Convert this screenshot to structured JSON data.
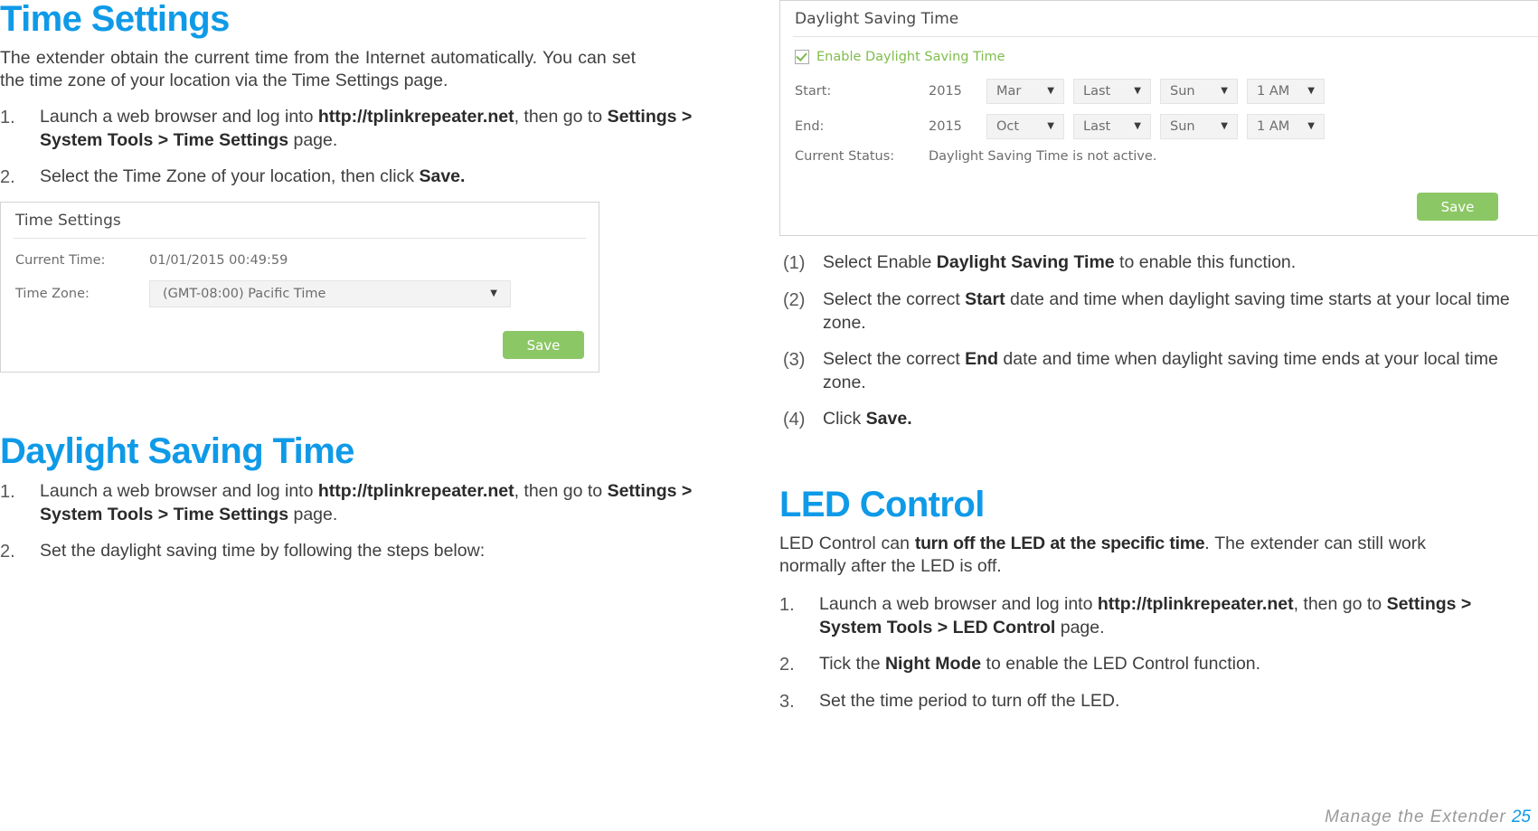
{
  "left_column": {
    "time_settings": {
      "heading": "Time Settings",
      "intro": "The extender obtain the current time from the Internet automatically. You can set the time zone of your location via the Time Settings page.",
      "steps": [
        {
          "num": "1.",
          "parts": [
            {
              "t": "Launch a web browser and log into ",
              "b": false
            },
            {
              "t": "http://tplinkrepeater.net",
              "b": true
            },
            {
              "t": ", then go to ",
              "b": false
            },
            {
              "t": "Settings > System Tools > Time Settings",
              "b": true
            },
            {
              "t": " page.",
              "b": false
            }
          ]
        },
        {
          "num": "2.",
          "parts": [
            {
              "t": "Select the Time Zone of your location, then click ",
              "b": false
            },
            {
              "t": "Save.",
              "b": true
            }
          ]
        }
      ],
      "ui": {
        "panel_title": "Time Settings",
        "current_time_label": "Current Time:",
        "current_time_value": "01/01/2015 00:49:59",
        "time_zone_label": "Time Zone:",
        "time_zone_value": "(GMT-08:00) Pacific Time",
        "save_label": "Save"
      }
    },
    "daylight_saving": {
      "heading": "Daylight Saving Time",
      "steps": [
        {
          "num": "1.",
          "parts": [
            {
              "t": "Launch a web browser and log into ",
              "b": false
            },
            {
              "t": "http://tplinkrepeater.net",
              "b": true
            },
            {
              "t": ", then go to ",
              "b": false
            },
            {
              "t": "Settings > System Tools > Time Settings",
              "b": true
            },
            {
              "t": " page.",
              "b": false
            }
          ]
        },
        {
          "num": "2.",
          "parts": [
            {
              "t": "Set the daylight saving time by following the steps below:",
              "b": false
            }
          ]
        }
      ]
    }
  },
  "right_column": {
    "dst_ui": {
      "panel_title": "Daylight Saving Time",
      "enable_label": "Enable Daylight Saving Time",
      "enable_checked": true,
      "start_label": "Start:",
      "start_year": "2015",
      "start_month": "Mar",
      "start_week": "Last",
      "start_day": "Sun",
      "start_time": "1 AM",
      "end_label": "End:",
      "end_year": "2015",
      "end_month": "Oct",
      "end_week": "Last",
      "end_day": "Sun",
      "end_time": "1 AM",
      "status_label": "Current Status:",
      "status_value": "Daylight Saving Time is not active.",
      "save_label": "Save"
    },
    "dst_substeps": [
      {
        "num": "(1)",
        "parts": [
          {
            "t": "Select Enable ",
            "b": false
          },
          {
            "t": "Daylight Saving Time",
            "b": true
          },
          {
            "t": " to enable this function.",
            "b": false
          }
        ]
      },
      {
        "num": "(2)",
        "parts": [
          {
            "t": "Select the correct ",
            "b": false
          },
          {
            "t": "Start",
            "b": true
          },
          {
            "t": " date and time when daylight saving time starts at your local time zone.",
            "b": false
          }
        ]
      },
      {
        "num": "(3)",
        "parts": [
          {
            "t": "Select the correct ",
            "b": false
          },
          {
            "t": "End",
            "b": true
          },
          {
            "t": " date and time when daylight saving time ends at your local time zone.",
            "b": false
          }
        ]
      },
      {
        "num": "(4)",
        "parts": [
          {
            "t": "Click ",
            "b": false
          },
          {
            "t": "Save.",
            "b": true
          }
        ]
      }
    ],
    "led_control": {
      "heading": "LED Control",
      "intro_parts": [
        {
          "t": "LED Control can ",
          "b": false,
          "e": false
        },
        {
          "t": "turn off the LED at the specific time",
          "b": false,
          "e": true
        },
        {
          "t": ". The extender can still work normally after the LED is off.",
          "b": false,
          "e": false
        }
      ],
      "steps": [
        {
          "num": "1.",
          "parts": [
            {
              "t": "Launch a web browser and log into ",
              "b": false
            },
            {
              "t": "http://tplinkrepeater.net",
              "b": true
            },
            {
              "t": ", then go to ",
              "b": false
            },
            {
              "t": "Settings > System Tools > LED Control",
              "b": true
            },
            {
              "t": " page.",
              "b": false
            }
          ]
        },
        {
          "num": "2.",
          "parts": [
            {
              "t": "Tick the ",
              "b": false
            },
            {
              "t": "Night Mode",
              "b": true
            },
            {
              "t": " to enable the LED Control function.",
              "b": false
            }
          ]
        },
        {
          "num": "3.",
          "parts": [
            {
              "t": "Set the time period to turn off the LED.",
              "b": false
            }
          ]
        }
      ]
    }
  },
  "footer": {
    "text": "Manage  the  Extender",
    "page_number": "25"
  },
  "colors": {
    "heading_blue": "#0f9ae8",
    "save_green": "#8cc765",
    "check_green": "#7fbd4c",
    "body_text": "#3f3f3f"
  }
}
